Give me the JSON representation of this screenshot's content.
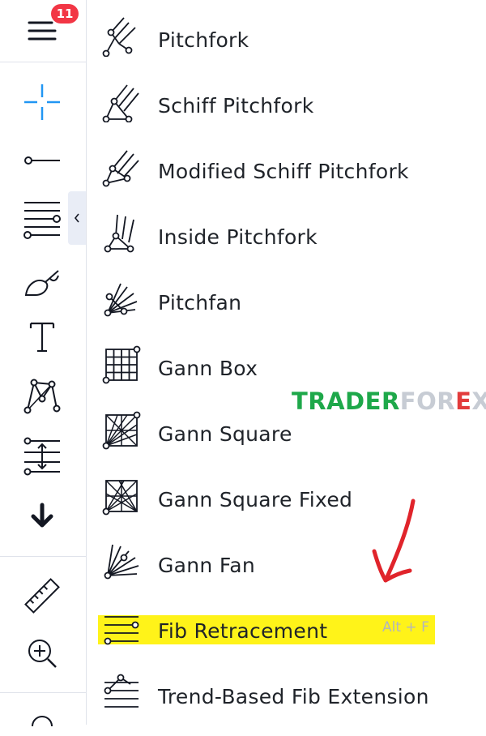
{
  "toolbar": {
    "badge_count": "11",
    "tools": [
      {
        "icon": "menu-icon"
      },
      {
        "icon": "crosshair-icon"
      },
      {
        "icon": "trend-line-icon"
      },
      {
        "icon": "fib-retracement-icon"
      },
      {
        "icon": "brush-icon"
      },
      {
        "icon": "text-icon"
      },
      {
        "icon": "pattern-icon"
      },
      {
        "icon": "prediction-icon"
      },
      {
        "icon": "arrow-down-icon"
      },
      {
        "icon": "ruler-icon"
      },
      {
        "icon": "zoom-in-icon"
      }
    ],
    "accent_color": "#2196f3"
  },
  "menu": {
    "items": [
      {
        "label": "Pitchfork",
        "icon": "pitchfork-icon"
      },
      {
        "label": "Schiff Pitchfork",
        "icon": "schiff-pitchfork-icon"
      },
      {
        "label": "Modified Schiff Pitchfork",
        "icon": "modified-schiff-pitchfork-icon"
      },
      {
        "label": "Inside Pitchfork",
        "icon": "inside-pitchfork-icon"
      },
      {
        "label": "Pitchfan",
        "icon": "pitchfan-icon"
      },
      {
        "label": "Gann Box",
        "icon": "gann-box-icon"
      },
      {
        "label": "Gann Square",
        "icon": "gann-square-icon"
      },
      {
        "label": "Gann Square Fixed",
        "icon": "gann-square-fixed-icon"
      },
      {
        "label": "Gann Fan",
        "icon": "gann-fan-icon"
      },
      {
        "label": "Fib Retracement",
        "icon": "fib-retracement-icon"
      },
      {
        "label": "Trend-Based Fib Extension",
        "icon": "trend-fib-extension-icon"
      }
    ],
    "highlighted_index": 9,
    "highlight_color": "#fff200",
    "shortcut": "Alt + F"
  },
  "watermark": {
    "part1": "TRADER",
    "part2": "FOR",
    "part3": "E",
    "part4": "X"
  },
  "annotation_color": "#e0242b"
}
